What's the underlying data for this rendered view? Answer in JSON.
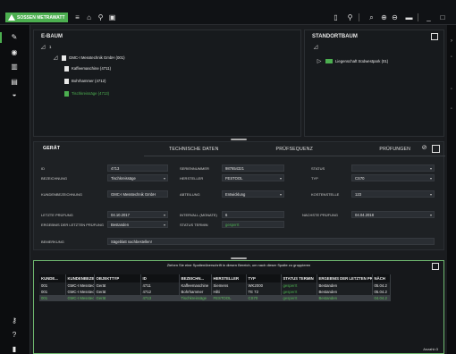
{
  "app": {
    "brand": "SOSSEN METRAWATT",
    "colors": {
      "accent": "#4caf50",
      "background": "#1a1c1f",
      "panel": "#171a1d"
    }
  },
  "topbar": {
    "icons": [
      "menu-icon",
      "home-icon",
      "pin-icon",
      "tab-icon"
    ],
    "right_icons": [
      "device-icon",
      "location-icon",
      "search-icon",
      "zoom-in-icon",
      "zoom-out-icon",
      "monitor-icon",
      "minimize-icon",
      "maximize-icon"
    ]
  },
  "leftrail": {
    "icons": [
      "wrench-icon",
      "globe-icon",
      "chart-icon",
      "id-card-icon",
      "dial-icon",
      "key-icon",
      "help-icon",
      "trash-icon"
    ]
  },
  "tree_left": {
    "title": "E-BAUM",
    "root_count": "1",
    "items": [
      {
        "label": "GMC-I Messtechnik GmbH (001)",
        "indent": 0,
        "muted": false
      },
      {
        "label": "Kaffeemaschine (4711)",
        "indent": 1,
        "muted": false
      },
      {
        "label": "Bohrhammer (4712)",
        "indent": 1,
        "muted": false
      },
      {
        "label": "Tischkreissäge (4713)",
        "indent": 1,
        "muted": true
      }
    ]
  },
  "tree_right": {
    "title": "STANDORTBAUM",
    "items": [
      {
        "label": "Liegenschaft Südwestpark (01)"
      }
    ]
  },
  "tabs": [
    {
      "label": "GERÄT",
      "active": true
    },
    {
      "label": "TECHNISCHE DATEN",
      "active": false
    },
    {
      "label": "PRÜFSEQUENZ",
      "active": false
    },
    {
      "label": "PRÜFUNGEN",
      "active": false
    }
  ],
  "form": {
    "id_label": "ID",
    "id_value": "4713",
    "seriennummer_label": "SERIENNUMMER",
    "seriennummer_value": "987654321",
    "status_label": "STATUS",
    "status_value": "",
    "bezeichnung_label": "BEZEICHNUNG",
    "bezeichnung_value": "Tischkreissäge",
    "hersteller_label": "HERSTELLER",
    "hersteller_value": "FESTOOL",
    "typ_label": "TYP",
    "typ_value": "CS70",
    "kunde_label": "KUNDENBEZEICHNUNG",
    "kunde_value": "GMC-I Messtechnik GmbH",
    "abteilung_label": "ABTEILUNG",
    "abteilung_value": "Entwicklung",
    "kostenstelle_label": "KOSTENSTELLE",
    "kostenstelle_value": "123",
    "letzte_label": "LETZTE PRÜFUNG",
    "letzte_value": "04.10.2017",
    "intervall_label": "INTERVALL (MONATE)",
    "intervall_value": "6",
    "naechste_label": "NÄCHSTE PRÜFUNG",
    "naechste_value": "04.04.2018",
    "ergebnis_label": "ERGEBNIS DER LETZTEN PRÜFUNG",
    "ergebnis_value": "Bestanden",
    "status_termin_label": "STATUS TERMIN",
    "status_termin_value": "gesperrt",
    "bemerkung_label": "BEMERKUNG",
    "bemerkung_value": "Sägeblatt nachbestellen!"
  },
  "grid": {
    "hint": "Ziehen Sie eine Spaltenüberschrift in diesen Bereich, um nach dieser Spalte zu gruppieren",
    "columns": [
      "KUNDE...",
      "KUNDENBEZEI...",
      "OBJEKTTYP",
      "ID",
      "BEZEICHN...",
      "HERSTELLER",
      "TYP",
      "STATUS TERMIN",
      "ERGEBNIS DER LETZTEN PRÜ...",
      "NÄCH"
    ],
    "rows": [
      [
        "001",
        "GMC-I Messtechni...",
        "Gerät",
        "4711",
        "Kaffeemaschine",
        "Siemens",
        "WK2000",
        "gesperrt",
        "Bestanden",
        "05.04.2"
      ],
      [
        "001",
        "GMC-I Messtechni...",
        "Gerät",
        "4712",
        "Bohrhammer",
        "Hilti",
        "TE 72",
        "gesperrt",
        "Bestanden",
        "05.04.2"
      ],
      [
        "001",
        "GMC-I Messtechni...",
        "Gerät",
        "4713",
        "Tischkreissäge",
        "FESTOOL",
        "CS70",
        "gesperrt",
        "Bestanden",
        "04.04.2"
      ]
    ],
    "selected_row": 2,
    "footer": "Anzahl=3"
  }
}
